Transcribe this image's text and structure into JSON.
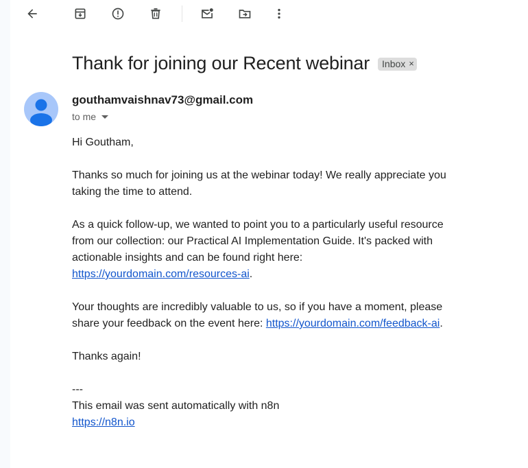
{
  "toolbar": {
    "buttons": [
      {
        "name": "back-button",
        "icon": "arrow-left-icon"
      },
      {
        "name": "archive-button",
        "icon": "archive-icon"
      },
      {
        "name": "report-spam-button",
        "icon": "report-icon"
      },
      {
        "name": "delete-button",
        "icon": "trash-icon"
      },
      {
        "name": "mark-unread-button",
        "icon": "mark-unread-icon"
      },
      {
        "name": "move-to-button",
        "icon": "move-to-folder-icon"
      },
      {
        "name": "more-options-button",
        "icon": "more-vertical-icon"
      }
    ]
  },
  "email": {
    "subject": "Thank for joining our Recent webinar",
    "label": "Inbox",
    "label_close": "×",
    "sender": "gouthamvaishnav73@gmail.com",
    "recipient_line": "to me",
    "greeting": "Hi Goutham,",
    "para1": "Thanks so much for joining us at the webinar today! We really appreciate you taking the time to attend.",
    "para2": "As a quick follow-up, we wanted to point you to a particularly useful resource from our collection: our Practical AI Implementation Guide. It's packed with actionable insights and can be found right here: ",
    "link1": "https://yourdomain.com/resources-ai",
    "para3": "Your thoughts are incredibly valuable to us, so if you have a moment, please share your feedback on the event here: ",
    "link2": "https://yourdomain.com/feedback-ai",
    "thanks": "Thanks again!",
    "sig_dashes": "---",
    "sig_text": "This email was sent automatically with n8n",
    "sig_link": "https://n8n.io",
    "period": "."
  },
  "colors": {
    "text": "#1f1f1f",
    "icon": "#444746",
    "link": "#1155cc",
    "avatar_bg": "#a8c7fa",
    "avatar_fg": "#1a73e8",
    "chip_bg": "#dddddd"
  }
}
